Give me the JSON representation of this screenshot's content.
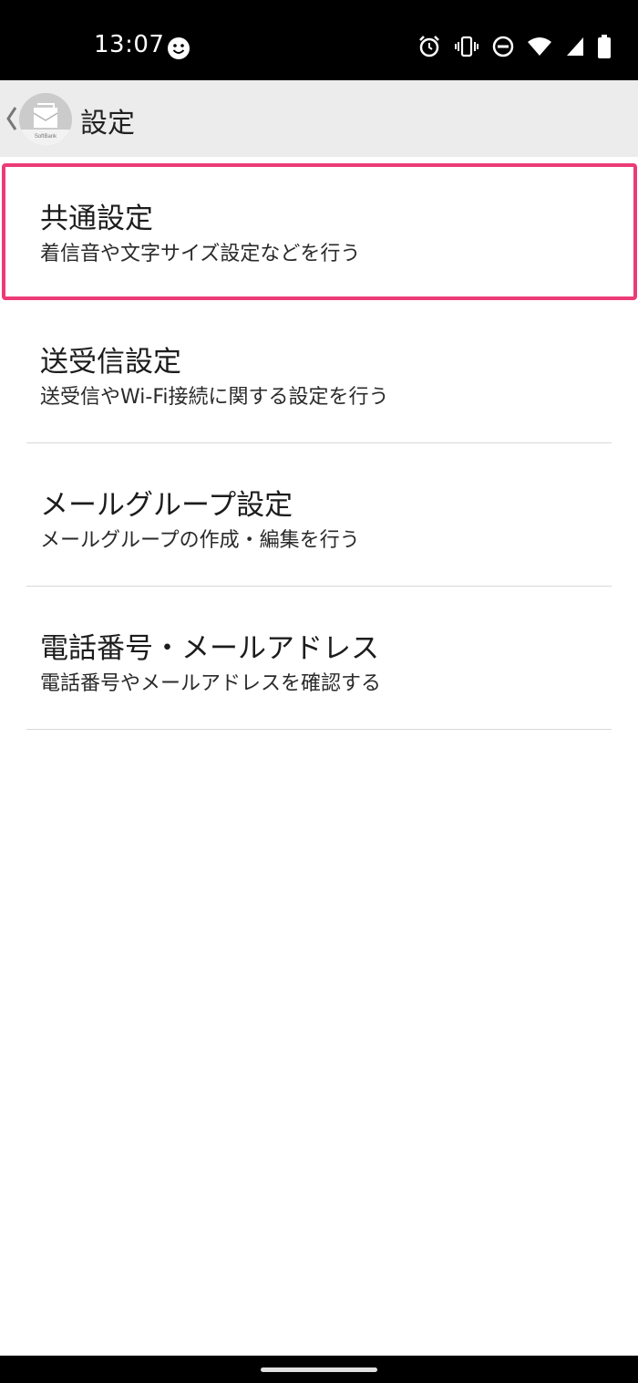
{
  "status_bar": {
    "time": "13:07",
    "icons": [
      "smiley-icon",
      "alarm-icon",
      "vibrate-icon",
      "do-not-disturb-icon",
      "wifi-icon",
      "signal-icon",
      "battery-icon"
    ]
  },
  "app_bar": {
    "title": "設定",
    "logo_text": "SoftBank"
  },
  "settings": {
    "items": [
      {
        "title": "共通設定",
        "subtitle": "着信音や文字サイズ設定などを行う"
      },
      {
        "title": "送受信設定",
        "subtitle": "送受信やWi-Fi接続に関する設定を行う"
      },
      {
        "title": "メールグループ設定",
        "subtitle": "メールグループの作成・編集を行う"
      },
      {
        "title": "電話番号・メールアドレス",
        "subtitle": "電話番号やメールアドレスを確認する"
      }
    ]
  },
  "colors": {
    "highlight": "#ec3b77",
    "app_bar_bg": "#ececec",
    "status_bar_bg": "#000000"
  }
}
